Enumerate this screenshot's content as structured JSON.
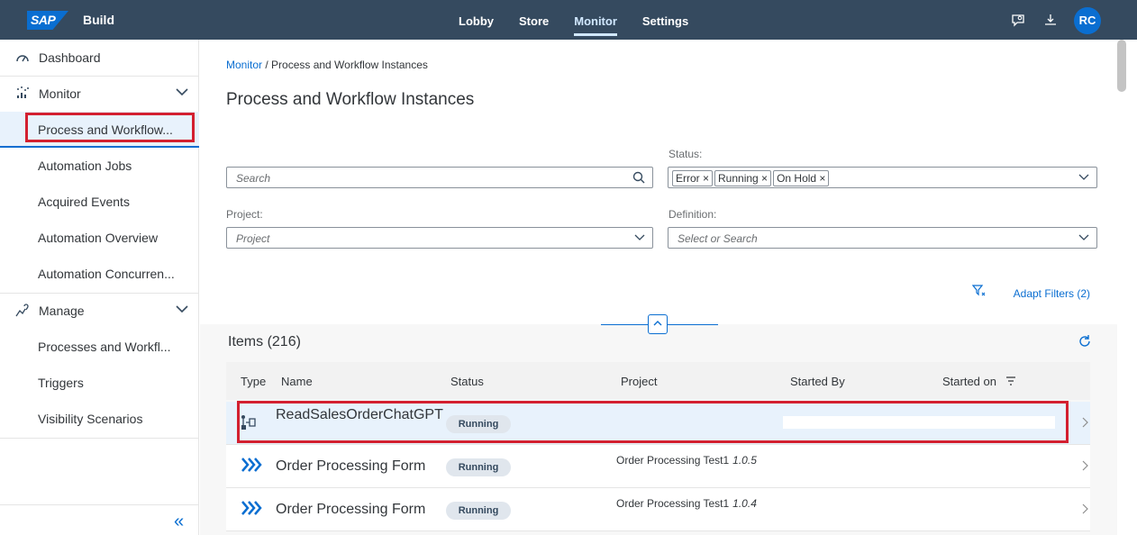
{
  "shell": {
    "logo": "SAP",
    "product": "Build",
    "nav": [
      "Lobby",
      "Store",
      "Monitor",
      "Settings"
    ],
    "avatar": "RC",
    "icons": [
      "feedback-icon",
      "download-icon"
    ]
  },
  "sidebar": {
    "dashboard": "Dashboard",
    "monitor": "Monitor",
    "monitor_items": [
      "Process and Workflow...",
      "Automation Jobs",
      "Acquired Events",
      "Automation Overview",
      "Automation Concurren..."
    ],
    "manage": "Manage",
    "manage_items": [
      "Processes and Workfl...",
      "Triggers",
      "Visibility Scenarios"
    ]
  },
  "breadcrumb": {
    "link": "Monitor",
    "rest": " / Process and Workflow Instances"
  },
  "page_title": "Process and Workflow Instances",
  "filters": {
    "search_placeholder": "Search",
    "status_label": "Status:",
    "status_tokens": [
      "Error",
      "Running",
      "On Hold"
    ],
    "project_label": "Project:",
    "project_placeholder": "Project",
    "definition_label": "Definition:",
    "definition_placeholder": "Select or Search",
    "adapt": "Adapt Filters (2)"
  },
  "table": {
    "title": "Items (216)",
    "columns": [
      "Type",
      "Name",
      "Status",
      "Project",
      "Started By",
      "Started on"
    ],
    "rows": [
      {
        "name": "ReadSalesOrderChatGPT",
        "status": "Running",
        "project": "",
        "version": ""
      },
      {
        "name": "Order Processing Form",
        "status": "Running",
        "project": "Order Processing Test1",
        "version": "1.0.5"
      },
      {
        "name": "Order Processing Form",
        "status": "Running",
        "project": "Order Processing Test1",
        "version": "1.0.4"
      }
    ]
  },
  "colors": {
    "shell": "#354a5f",
    "accent": "#0a6ed1",
    "highlight": "#d32030"
  }
}
